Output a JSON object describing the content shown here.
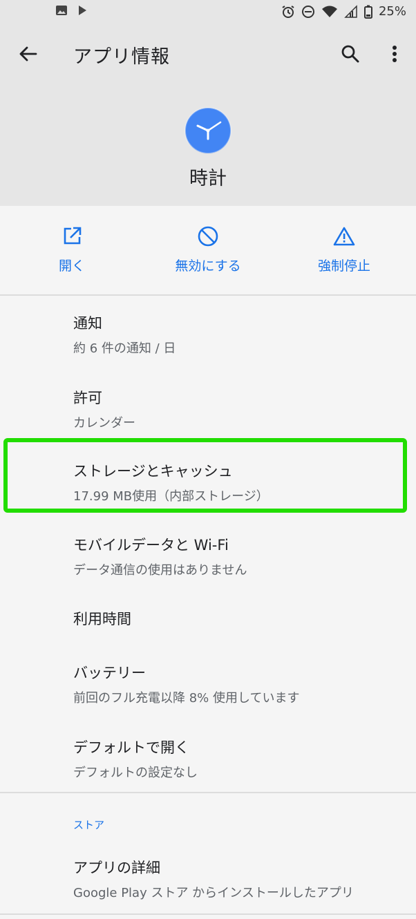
{
  "status_bar": {
    "battery": "25%",
    "icons": [
      "image-icon",
      "play-icon",
      "alarm-icon",
      "dnd-icon",
      "wifi-icon",
      "signal-icon",
      "battery-icon"
    ]
  },
  "app_bar": {
    "title": "アプリ情報",
    "icons": [
      "back-arrow-icon",
      "search-icon",
      "more-vert-icon"
    ]
  },
  "app": {
    "name": "時計",
    "icon": "clock-app-icon",
    "accent": "#4285f4"
  },
  "actions": {
    "open": "開く",
    "disable": "無効にする",
    "force_stop": "強制停止",
    "color": "#1a73e8"
  },
  "items": [
    {
      "title": "通知",
      "subtitle": "約 6 件の通知 / 日"
    },
    {
      "title": "許可",
      "subtitle": "カレンダー"
    },
    {
      "title": "ストレージとキャッシュ",
      "subtitle": "17.99 MB使用（内部ストレージ）"
    },
    {
      "title": "モバイルデータと Wi-Fi",
      "subtitle": "データ通信の使用はありません"
    },
    {
      "title": "利用時間"
    },
    {
      "title": "バッテリー",
      "subtitle": "前回のフル充電以降 8% 使用しています"
    },
    {
      "title": "デフォルトで開く",
      "subtitle": "デフォルトの設定なし"
    }
  ],
  "store_section": {
    "header": "ストア",
    "item": {
      "title": "アプリの詳細",
      "subtitle": "Google Play ストア からインストールしたアプリ"
    }
  },
  "highlight_color": "#22dd00"
}
